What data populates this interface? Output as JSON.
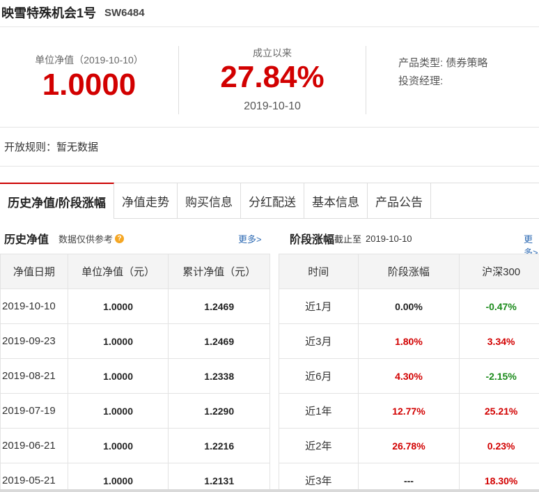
{
  "header": {
    "name": "映雪特殊机会1号",
    "code": "SW6484"
  },
  "summary": {
    "nav_label": "单位净值（2019-10-10）",
    "nav_value": "1.0000",
    "since_label": "成立以来",
    "since_value": "27.84%",
    "since_date": "2019-10-10",
    "type_label": "产品类型:",
    "type_value": "债券策略",
    "manager_label": "投资经理:"
  },
  "rule": {
    "text": "开放规则：暂无数据"
  },
  "tabs": [
    {
      "label": "历史净值/阶段涨幅"
    },
    {
      "label": "净值走势"
    },
    {
      "label": "购买信息"
    },
    {
      "label": "分红配送"
    },
    {
      "label": "基本信息"
    },
    {
      "label": "产品公告"
    }
  ],
  "history": {
    "title": "历史净值",
    "note": "数据仅供参考",
    "more": "更多>",
    "headers": [
      "净值日期",
      "单位净值（元）",
      "累计净值（元）"
    ],
    "rows": [
      [
        "2019-10-10",
        "1.0000",
        "1.2469"
      ],
      [
        "2019-09-23",
        "1.0000",
        "1.2469"
      ],
      [
        "2019-08-21",
        "1.0000",
        "1.2338"
      ],
      [
        "2019-07-19",
        "1.0000",
        "1.2290"
      ],
      [
        "2019-06-21",
        "1.0000",
        "1.2216"
      ],
      [
        "2019-05-21",
        "1.0000",
        "1.2131"
      ]
    ]
  },
  "performance": {
    "title": "阶段涨幅",
    "cutoff_label": "截止至",
    "cutoff_date": "2019-10-10",
    "more": "更多>",
    "headers": [
      "时间",
      "阶段涨幅",
      "沪深300"
    ],
    "rows": [
      [
        "近1月",
        "0.00%",
        "-0.47%"
      ],
      [
        "近3月",
        "1.80%",
        "3.34%"
      ],
      [
        "近6月",
        "4.30%",
        "-2.15%"
      ],
      [
        "近1年",
        "12.77%",
        "25.21%"
      ],
      [
        "近2年",
        "26.78%",
        "0.23%"
      ],
      [
        "近3年",
        "---",
        "18.30%"
      ]
    ]
  },
  "colors": {
    "up": "#d20000",
    "down": "#1a8a1a",
    "link": "#2d6ab3",
    "tab_accent": "#cc0000"
  }
}
